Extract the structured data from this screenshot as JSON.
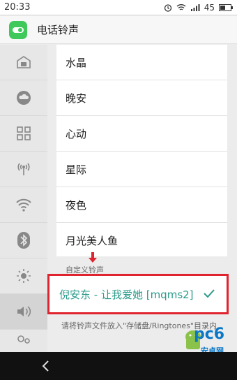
{
  "status_bar": {
    "time": "20:33",
    "battery": "45"
  },
  "app_bar": {
    "title": "电话铃声"
  },
  "ringtones": [
    {
      "label": "水晶"
    },
    {
      "label": "晚安"
    },
    {
      "label": "心动"
    },
    {
      "label": "星际"
    },
    {
      "label": "夜色"
    },
    {
      "label": "月光美人鱼"
    }
  ],
  "custom": {
    "section_label": "自定义铃声",
    "selected": "倪安东 - 让我爱她 [mqms2]",
    "hint": "请将铃声文件放入\"存储盘/Ringtones\"目录内"
  },
  "sidebar": {
    "items": [
      "home-icon",
      "cloud-icon",
      "apps-icon",
      "antenna-icon",
      "wifi-icon",
      "bluetooth-icon",
      "brightness-icon",
      "volume-icon",
      "accounts-icon"
    ]
  },
  "colors": {
    "accent": "#2a9a8a",
    "highlight_box": "#e0242f",
    "app_icon": "#3ec95a"
  }
}
